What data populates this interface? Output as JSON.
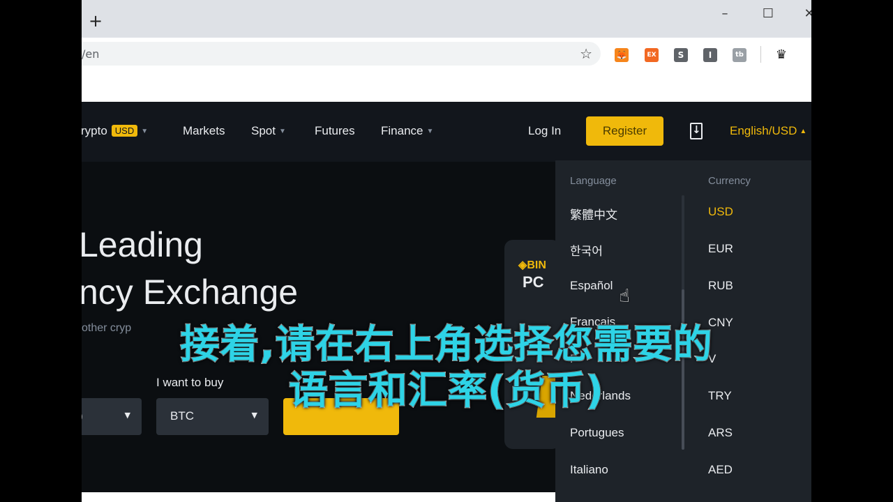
{
  "browser": {
    "new_tab": "+",
    "url": "/en",
    "window_controls": [
      "–",
      "☐",
      "✕"
    ],
    "extensions": [
      {
        "name": "metamask-icon",
        "label": "🦊",
        "color": "#f6851b"
      },
      {
        "name": "ex-icon",
        "label": "EX",
        "color": "#f26822"
      },
      {
        "name": "s-icon",
        "label": "S",
        "color": "#5f6368"
      },
      {
        "name": "i-icon",
        "label": "I",
        "color": "#5f6368"
      },
      {
        "name": "tb-icon",
        "label": "tb",
        "color": "#9aa0a6"
      }
    ]
  },
  "nav": {
    "buy_crypto": "rypto",
    "usd_badge": "USD",
    "markets": "Markets",
    "spot": "Spot",
    "futures": "Futures",
    "finance": "Finance",
    "login": "Log In",
    "register": "Register",
    "language_currency": "English/USD"
  },
  "hero": {
    "headline1": "Leading",
    "headline2": "ncy Exchange",
    "subtext": "other cryp",
    "want_to_buy": "I want to buy",
    "left_select": ")",
    "coin_select": "BTC"
  },
  "promo": {
    "logo": "BIN",
    "text": "PC"
  },
  "dropdown": {
    "language_header": "Language",
    "currency_header": "Currency",
    "languages": [
      "繁體中文",
      "한국어",
      "Español",
      "Français",
      "P",
      "Nederlands",
      "Portugues",
      "Italiano"
    ],
    "currencies": [
      "USD",
      "EUR",
      "RUB",
      "CNY",
      "V",
      "TRY",
      "ARS",
      "AED"
    ]
  },
  "subtitles": {
    "line1": "接着,请在右上角选择您需要的",
    "line2": "语言和汇率(货币)"
  },
  "colors": {
    "brand_yellow": "#f0b90b",
    "subtitle": "#2ed3e6"
  }
}
